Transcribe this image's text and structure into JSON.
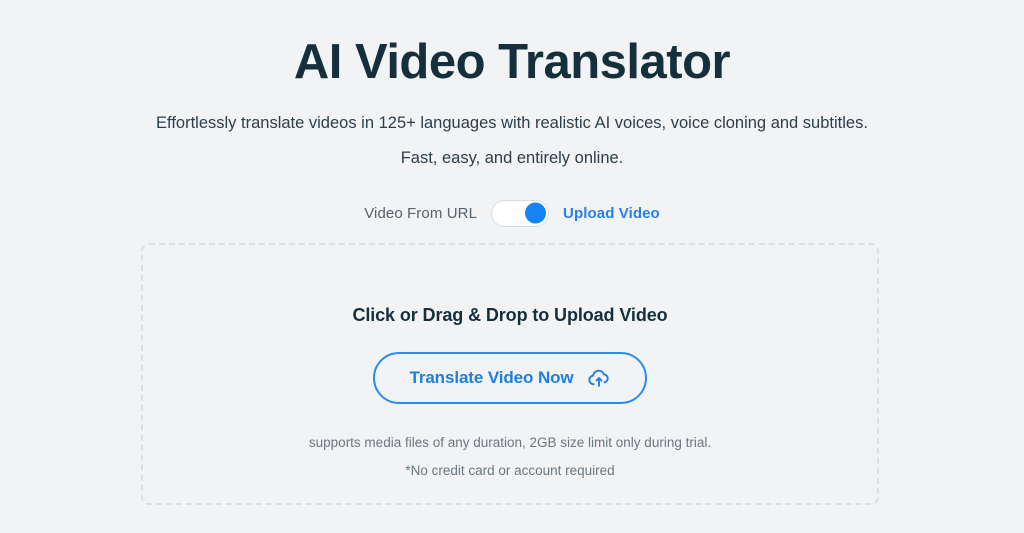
{
  "hero": {
    "title": "AI Video Translator",
    "subtitle_line1": "Effortlessly translate videos in 125+ languages with realistic AI voices, voice cloning and subtitles.",
    "subtitle_line2": "Fast, easy, and entirely online."
  },
  "source_toggle": {
    "left_label": "Video From URL",
    "right_label": "Upload Video",
    "state": "Upload Video",
    "knob_position": "right",
    "knob_color": "#1683f0",
    "active_label_color": "#2b7fe8",
    "inactive_label_color": "#56626c"
  },
  "dropzone": {
    "title": "Click or Drag & Drop to Upload Video",
    "button_label": "Translate Video Now",
    "button_icon": "cloud-upload-icon",
    "button_color": "#1d7fe0",
    "border_color": "#dcdfe2",
    "note_line1": "supports media files of any duration, 2GB size limit only during trial.",
    "note_line2": "*No credit card or account required"
  },
  "theme": {
    "background": "#f1f3f4",
    "heading_color": "#15303c",
    "body_color": "#2d3f49",
    "muted_color": "#6b7780",
    "accent_blue": "#2b8cf0"
  }
}
